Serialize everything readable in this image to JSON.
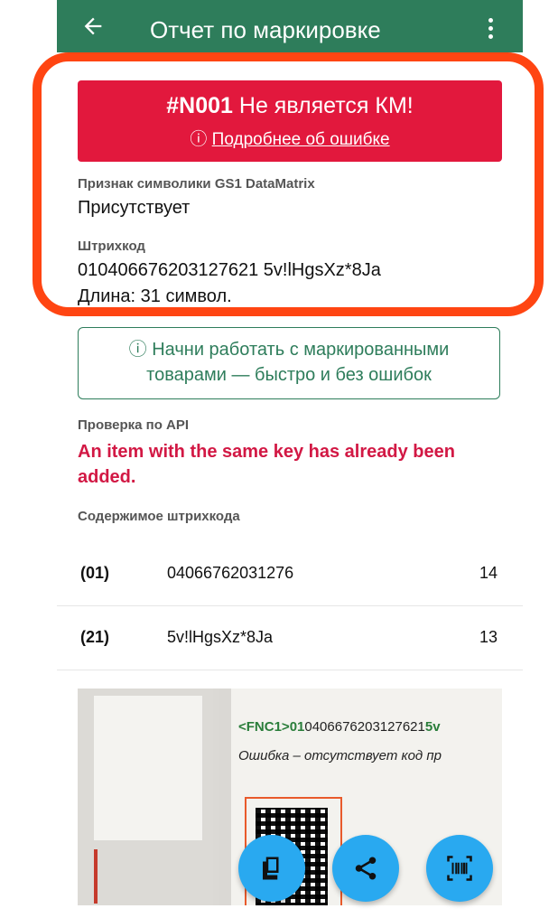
{
  "appbar": {
    "title": "Отчет по маркировке"
  },
  "error": {
    "code": "#N001",
    "message": "Не является КМ!",
    "link_icon": "ⓘ",
    "link": "Подробнее об ошибке"
  },
  "gs1": {
    "label": "Признак символики GS1 DataMatrix",
    "value": "Присутствует"
  },
  "barcode": {
    "label": "Штрихкод",
    "value": "010406676203127621 5v!lHgsXz*8Ja",
    "length": "Длина: 31 символ."
  },
  "promo": {
    "icon": "ⓘ",
    "line1": "Начни работать с маркированными",
    "line2": "товарами — быстро и без ошибок"
  },
  "api": {
    "label": "Проверка по API",
    "line1": "An item with the same key has already been",
    "line2": "added."
  },
  "contents": {
    "label": "Содержимое штрихкода",
    "rows": [
      {
        "ai": "(01)",
        "value": "04066762031276",
        "length": "14"
      },
      {
        "ai": "(21)",
        "value": "5v!lHgsXz*8Ja",
        "length": "13"
      }
    ]
  },
  "photo": {
    "code_prefix": "<FNC1>01",
    "code_rest": "0406676203127621",
    "code_tail": "5v",
    "error_text": "Ошибка – отсутствует код пр"
  },
  "fab": {
    "copy_icon": "copy-icon",
    "share_icon": "share-icon",
    "scan_icon": "barcode-scan-icon"
  },
  "colors": {
    "appbar": "#2e7d5b",
    "error": "#e2183d",
    "api_error": "#d21844",
    "fab": "#29a9f0",
    "highlight": "#ff4512"
  }
}
